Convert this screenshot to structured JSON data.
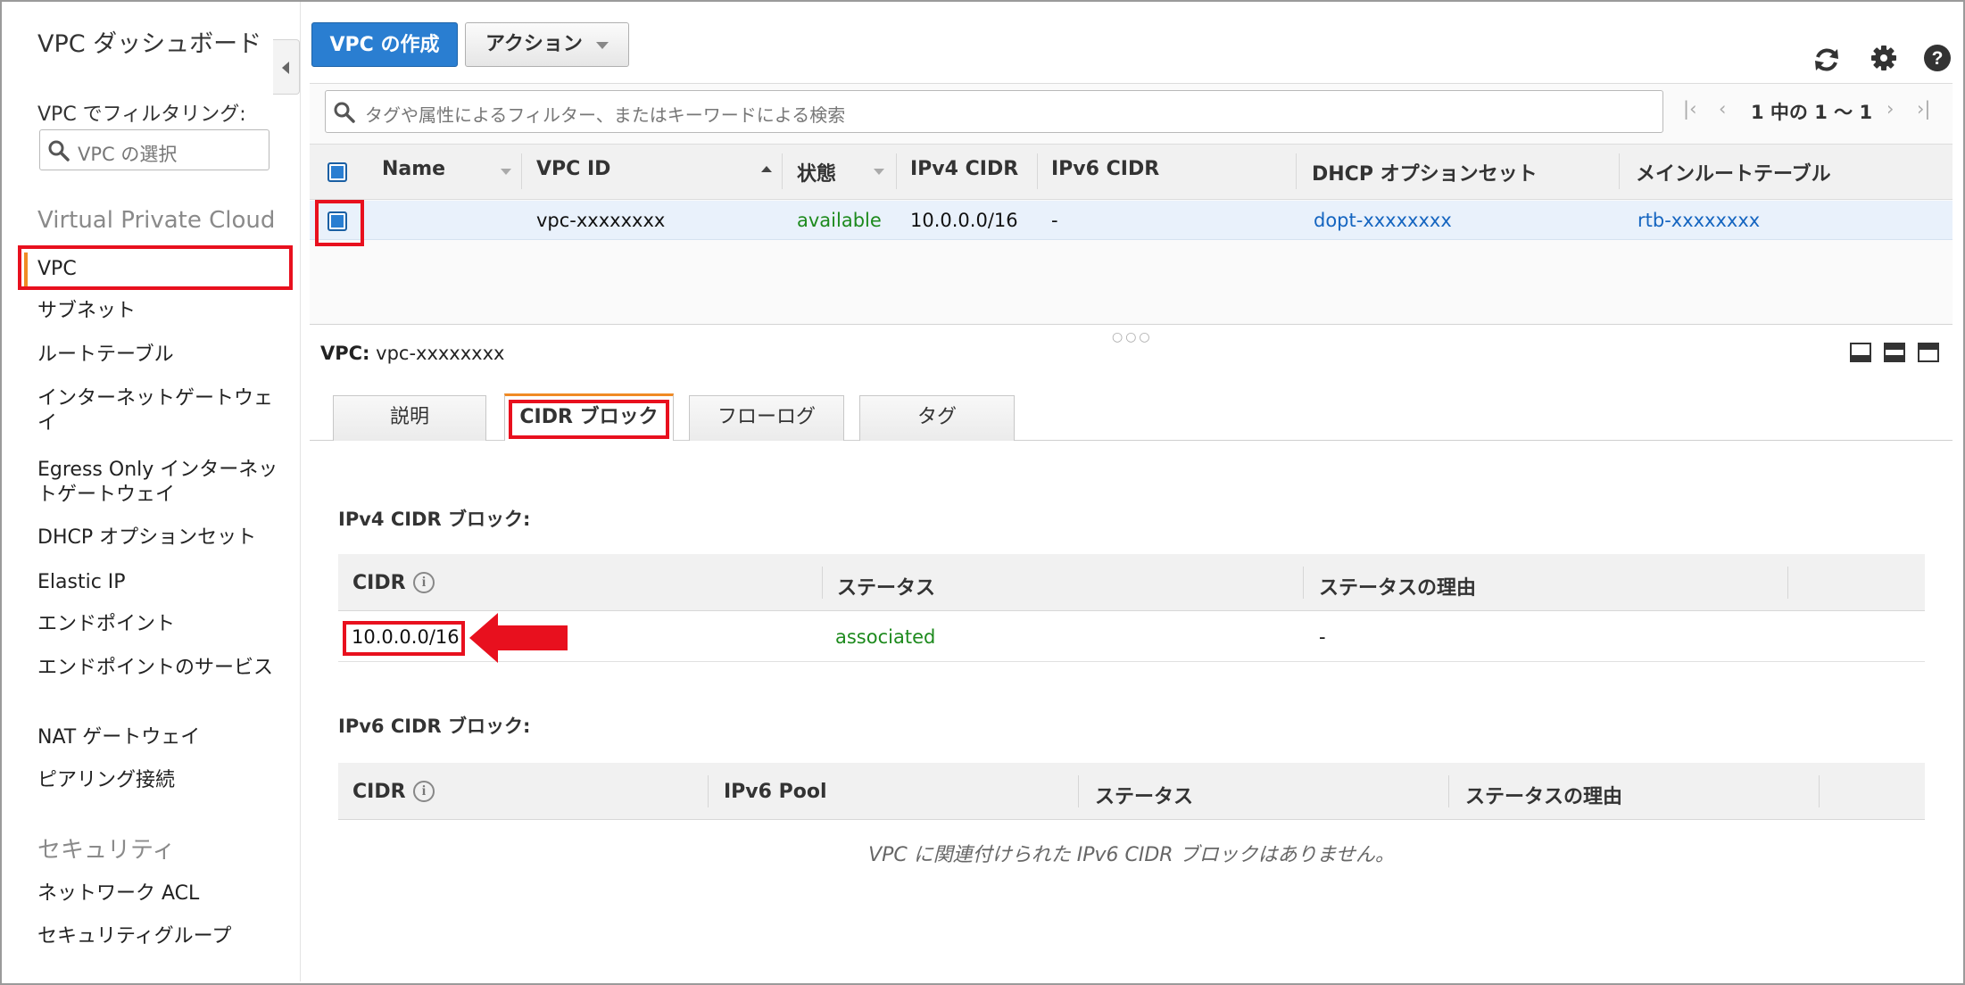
{
  "sidebar": {
    "title": "VPC ダッシュボード",
    "filter_label": "VPC でフィルタリング:",
    "select_placeholder": "VPC の選択",
    "section_vpc": "Virtual Private Cloud",
    "items_vpc": [
      {
        "label": "VPC"
      },
      {
        "label": "サブネット"
      },
      {
        "label": "ルートテーブル"
      },
      {
        "label": "インターネットゲートウェイ"
      },
      {
        "label": "Egress Only インターネットゲートウェイ"
      },
      {
        "label": "DHCP オプションセット"
      },
      {
        "label": "Elastic IP"
      },
      {
        "label": "エンドポイント"
      },
      {
        "label": "エンドポイントのサービス"
      },
      {
        "label": "NAT ゲートウェイ"
      },
      {
        "label": "ピアリング接続"
      }
    ],
    "section_security": "セキュリティ",
    "items_security": [
      {
        "label": "ネットワーク ACL"
      },
      {
        "label": "セキュリティグループ"
      }
    ]
  },
  "toolbar": {
    "create_label": "VPC の作成",
    "action_label": "アクション"
  },
  "search": {
    "placeholder": "タグや属性によるフィルター、またはキーワードによる検索"
  },
  "pager": {
    "text": "1 中の 1 〜 1"
  },
  "grid": {
    "columns": [
      "Name",
      "VPC ID",
      "状態",
      "IPv4 CIDR",
      "IPv6 CIDR",
      "DHCP オプションセット",
      "メインルートテーブル"
    ],
    "rows": [
      {
        "name": "",
        "vpc_id": "vpc-xxxxxxxx",
        "state": "available",
        "ipv4": "10.0.0.0/16",
        "ipv6": "-",
        "dhcp": "dopt-xxxxxxxx",
        "route": "rtb-xxxxxxxx"
      }
    ]
  },
  "detail": {
    "label_prefix": "VPC:",
    "vpc_id": "vpc-xxxxxxxx",
    "tabs": [
      {
        "label": "説明"
      },
      {
        "label": "CIDR ブロック"
      },
      {
        "label": "フローログ"
      },
      {
        "label": "タグ"
      }
    ],
    "ipv4_title": "IPv4 CIDR ブロック:",
    "ipv4_columns": [
      "CIDR",
      "ステータス",
      "ステータスの理由"
    ],
    "ipv4_rows": [
      {
        "cidr": "10.0.0.0/16",
        "status": "associated",
        "reason": "-"
      }
    ],
    "ipv6_title": "IPv6 CIDR ブロック:",
    "ipv6_columns": [
      "CIDR",
      "IPv6 Pool",
      "ステータス",
      "ステータスの理由"
    ],
    "ipv6_empty": "VPC に関連付けられた IPv6 CIDR ブロックはありません。"
  },
  "colors": {
    "primary_button": "#2a7ed1",
    "highlight": "#e8101e",
    "status_green": "#1d8a1d",
    "link": "#1565c0",
    "active_accent": "#f08a24"
  },
  "icons": [
    "search-icon",
    "refresh-icon",
    "gear-icon",
    "help-icon",
    "chevron-down-icon",
    "collapse-icon",
    "info-icon",
    "arrow-icon"
  ]
}
